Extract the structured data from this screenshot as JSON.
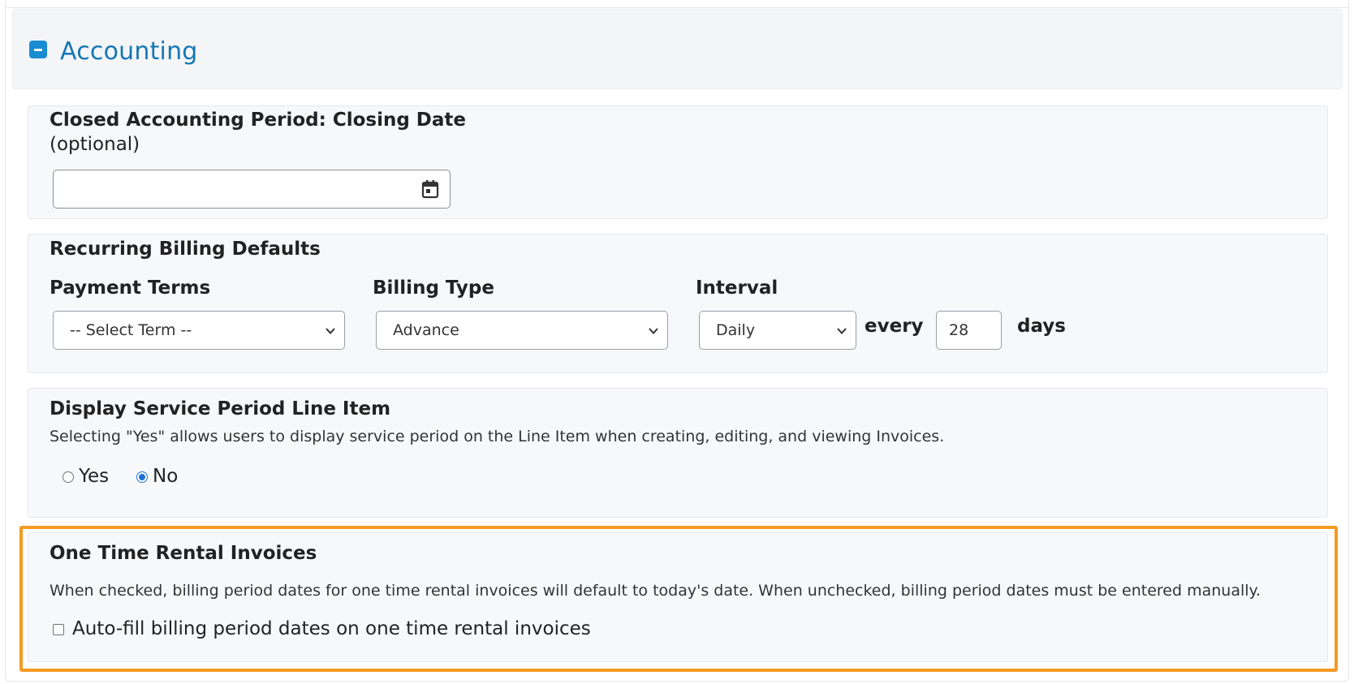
{
  "section": {
    "title": "Accounting",
    "collapse_icon": "minus-square-icon",
    "accent": "#1a8dd2"
  },
  "closing": {
    "title": "Closed Accounting Period: Closing Date",
    "optional": "(optional)",
    "date_value": "",
    "calendar_icon": "calendar-icon"
  },
  "billing": {
    "title": "Recurring Billing Defaults",
    "payment_terms_label": "Payment Terms",
    "payment_terms_value": "-- Select Term --",
    "billing_type_label": "Billing Type",
    "billing_type_value": "Advance",
    "interval_label": "Interval",
    "interval_value": "Daily",
    "every_label": "every",
    "every_value": "28",
    "days_label": "days"
  },
  "service": {
    "title": "Display Service Period Line Item",
    "help": "Selecting \"Yes\" allows users to display service period on the Line Item when creating, editing, and viewing Invoices.",
    "yes_label": "Yes",
    "no_label": "No",
    "selected": "No"
  },
  "rental": {
    "title": "One Time Rental Invoices",
    "help": "When checked, billing period dates for one time rental invoices will default to today's date. When unchecked, billing period dates must be entered manually.",
    "checkbox_label": "Auto-fill billing period dates on one time rental invoices",
    "checked": false,
    "highlight_color": "#f59a23"
  }
}
